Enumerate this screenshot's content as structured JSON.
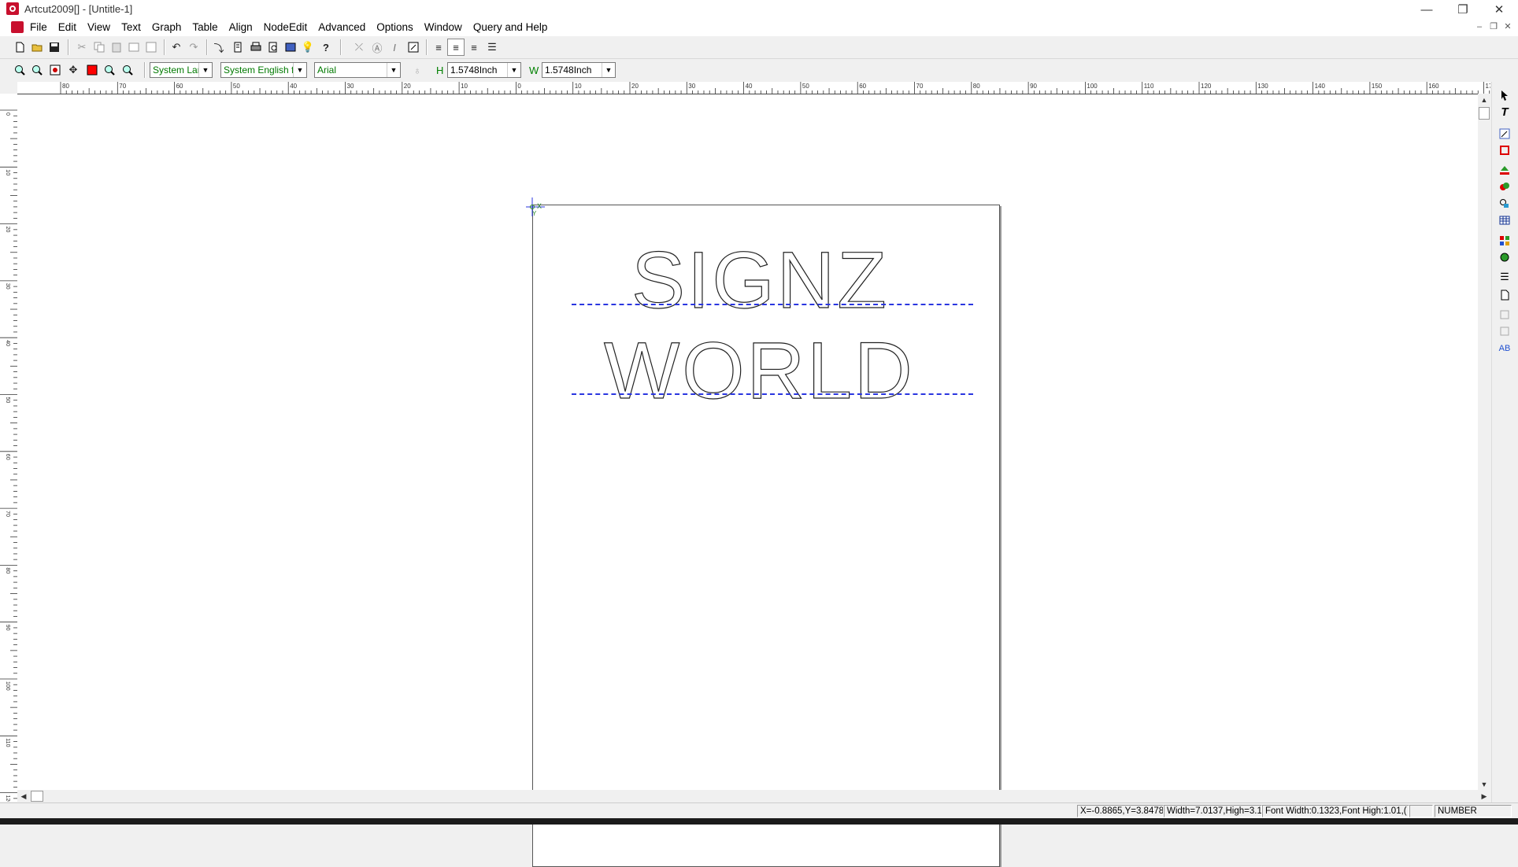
{
  "window": {
    "title": "Artcut2009[] - [Untitle-1]",
    "controls": {
      "minimize": "—",
      "restore": "❐",
      "close": "✕"
    }
  },
  "menu": {
    "items": [
      "File",
      "Edit",
      "View",
      "Text",
      "Graph",
      "Table",
      "Align",
      "NodeEdit",
      "Advanced",
      "Options",
      "Window",
      "Query and Help"
    ],
    "mdi": {
      "minimize": "–",
      "restore": "❐",
      "close": "✕"
    }
  },
  "toolbar2": {
    "language_combo": "System Lar",
    "font_set_combo": "System English fo",
    "font_combo": "Arial",
    "height_label": "H",
    "height_value": "1.5748Inch",
    "width_label": "W",
    "width_value": "1.5748Inch",
    "fill_color": "#ff0000"
  },
  "ruler": {
    "h_labels": [
      "80",
      "70",
      "60",
      "50",
      "40",
      "30",
      "20",
      "10",
      "0",
      "10",
      "20",
      "30",
      "40",
      "50",
      "60",
      "70",
      "80",
      "90",
      "100",
      "110",
      "120",
      "130",
      "140",
      "150",
      "160",
      "17"
    ],
    "v_labels": [
      "0",
      "10",
      "20",
      "30",
      "40",
      "50",
      "60",
      "70",
      "80",
      "90",
      "100",
      "110",
      "120"
    ]
  },
  "canvas": {
    "line1": "SIGNZ",
    "line2": "WORLD",
    "origin_x_label": "X",
    "origin_y_label": "Y",
    "baseline_color": "#2a36e0"
  },
  "status": {
    "coords": "X=-0.8865,Y=3.8478",
    "size": "Width=7.0137,High=3.1",
    "font": "Font Width:0.1323,Font High:1.01,(",
    "numlock": "NUMBER"
  }
}
